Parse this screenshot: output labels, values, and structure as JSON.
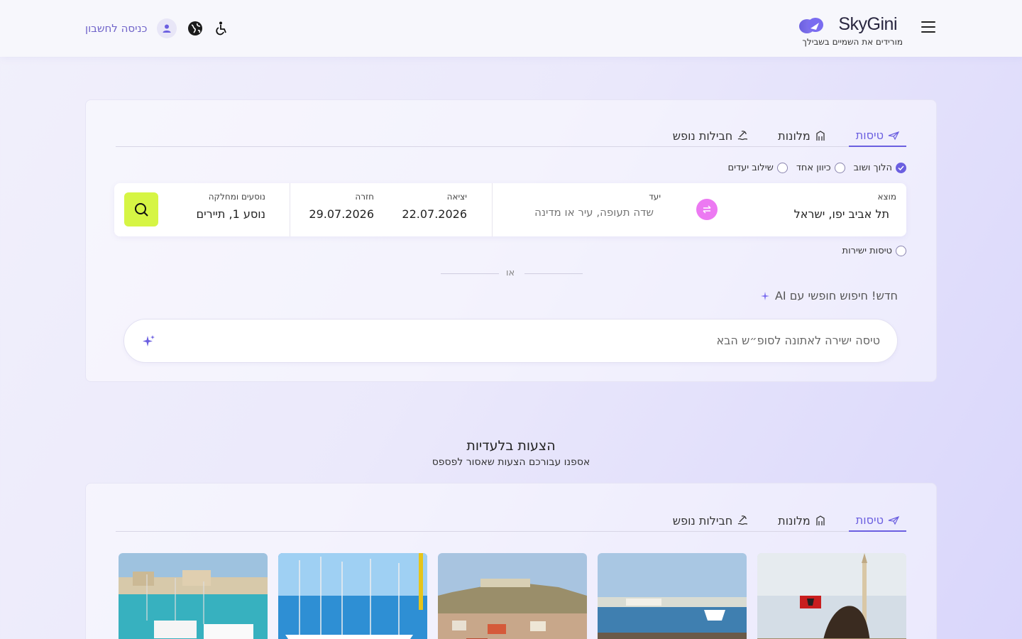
{
  "header": {
    "brand": "SkyGini",
    "tagline": "מורידים את השמיים בשבילך",
    "login": "כניסה לחשבון"
  },
  "search": {
    "tabs": [
      {
        "label": "טיסות",
        "icon": "plane-icon",
        "active": true
      },
      {
        "label": "מלונות",
        "icon": "building-icon",
        "active": false
      },
      {
        "label": "חבילות נופש",
        "icon": "beach-icon",
        "active": false
      }
    ],
    "trip_types": [
      {
        "label": "הלוך ושוב",
        "checked": true
      },
      {
        "label": "כיוון אחד",
        "checked": false
      },
      {
        "label": "שילוב יעדים",
        "checked": false
      }
    ],
    "origin": {
      "label": "מוצא",
      "value": "תל אביב יפו, ישראל"
    },
    "destination": {
      "label": "יעד",
      "placeholder": "שדה תעופה, עיר או מדינה"
    },
    "departure": {
      "label": "יציאה",
      "value": "22.07.2026"
    },
    "return": {
      "label": "חזרה",
      "value": "29.07.2026"
    },
    "passengers": {
      "label": "נוסעים ומחלקה",
      "value": "נוסע 1, תיירים"
    },
    "direct_flights": "טיסות ישירות",
    "or": "או",
    "ai_label": "חדש! חיפוש חופשי עם AI",
    "ai_placeholder": "טיסה ישירה לאתונה לסופ״ש הבא"
  },
  "deals": {
    "title": "הצעות בלעדיות",
    "subtitle": "אספנו עבורכם הצעות שאסור לפספס",
    "tabs": [
      {
        "label": "טיסות",
        "icon": "plane-icon",
        "active": true
      },
      {
        "label": "מלונות",
        "icon": "building-icon",
        "active": false
      },
      {
        "label": "חבילות נופש",
        "icon": "beach-icon",
        "active": false
      }
    ]
  },
  "colors": {
    "accent": "#6b5fe0",
    "search_button": "#d6f544",
    "swap_button": "#ec79f2"
  }
}
